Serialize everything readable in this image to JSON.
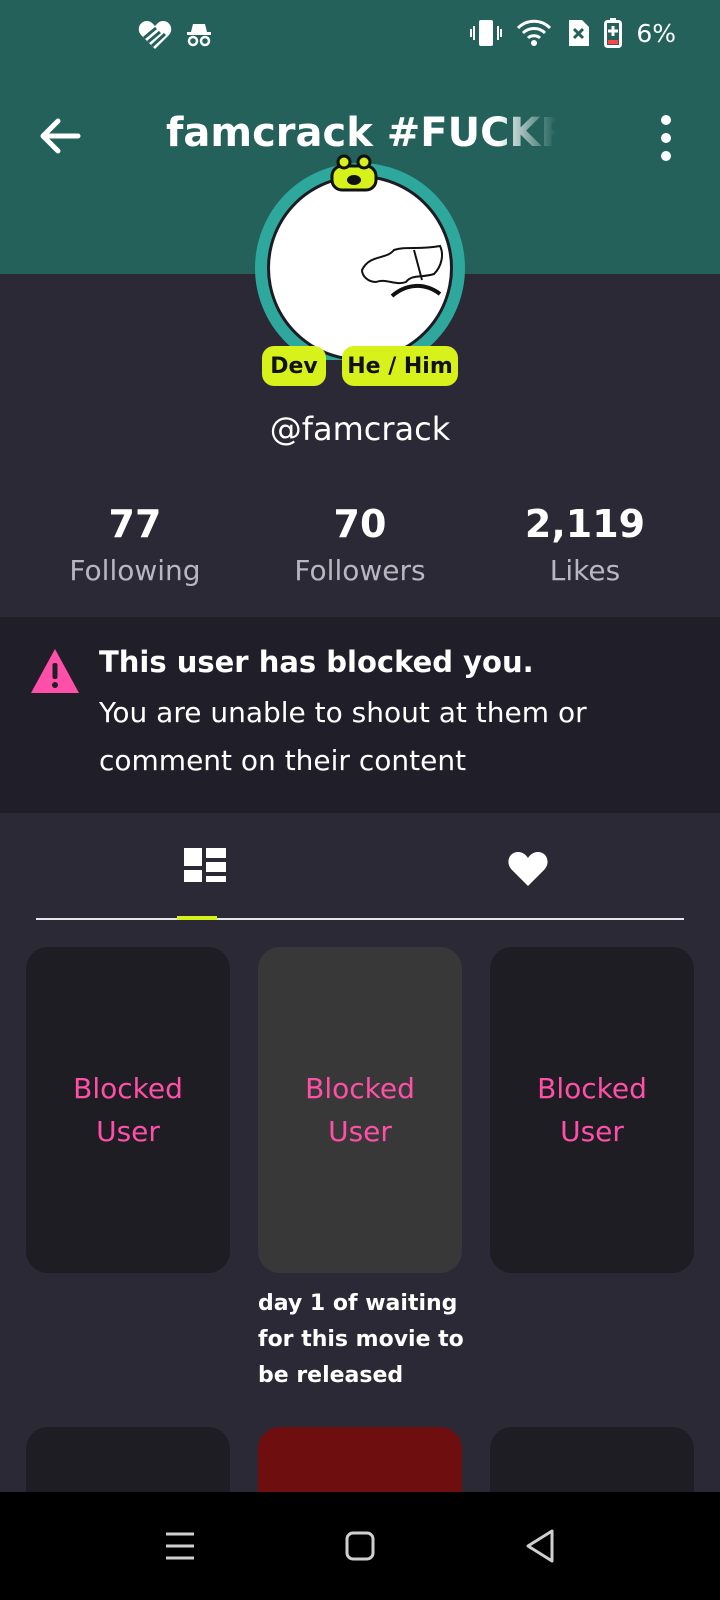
{
  "status_bar": {
    "battery_percent": "6%",
    "left_icons": [
      "heart-icon",
      "incognito-icon"
    ],
    "right_icons": [
      "vibrate-icon",
      "wifi-icon",
      "sim-x-icon",
      "battery-icon"
    ]
  },
  "header": {
    "title": "famcrack #FUCKRC",
    "bg_color": "#23615a"
  },
  "profile": {
    "badges": [
      "Dev",
      "He / Him"
    ],
    "handle": "@famcrack",
    "badge_color": "#d7f21a"
  },
  "stats": [
    {
      "value": "77",
      "label": "Following"
    },
    {
      "value": "70",
      "label": "Followers"
    },
    {
      "value": "2,119",
      "label": "Likes"
    }
  ],
  "blocked_notice": {
    "title": "This user has blocked you.",
    "text": "You are unable to shout at them or comment on their content",
    "icon": "warning-icon",
    "icon_color": "#ff4fa8"
  },
  "tabs": [
    {
      "name": "posts-grid",
      "icon": "grid-icon",
      "selected": true
    },
    {
      "name": "liked",
      "icon": "heart-icon",
      "selected": false
    }
  ],
  "posts": [
    {
      "label": "Blocked\nUser",
      "bg": "#1e1d24"
    },
    {
      "label": "Blocked\nUser",
      "bg": "#383838",
      "caption": "day 1 of waiting for this movie to be released"
    },
    {
      "label": "Blocked\nUser",
      "bg": "#1e1d24"
    }
  ],
  "posts_row2": [
    {
      "bg": "#1e1d24"
    },
    {
      "bg": "#6e0e0e"
    },
    {
      "bg": "#1e1d24"
    }
  ],
  "nav": [
    "menu-icon",
    "home-icon",
    "back-icon"
  ]
}
